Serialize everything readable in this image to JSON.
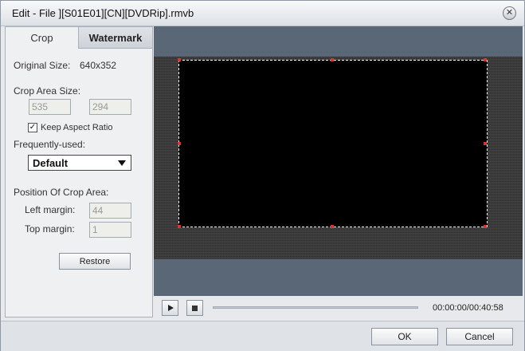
{
  "window": {
    "title": "Edit - File ][S01E01][CN][DVDRip].rmvb",
    "close_icon": "close-icon"
  },
  "tabs": [
    {
      "label": "Crop"
    },
    {
      "label": "Watermark"
    }
  ],
  "crop": {
    "original_size_label": "Original Size:",
    "original_size_value": "640x352",
    "crop_area_size_label": "Crop Area Size:",
    "width_value": "535",
    "height_value": "294",
    "keep_aspect_label": "Keep Aspect Ratio",
    "keep_aspect_checked": true,
    "check_mark": "✓",
    "frequently_used_label": "Frequently-used:",
    "frequently_used_selected": "Default",
    "position_label": "Position Of Crop Area:",
    "left_margin_label": "Left margin:",
    "left_margin_value": "44",
    "top_margin_label": "Top margin:",
    "top_margin_value": "1",
    "restore_label": "Restore"
  },
  "playback": {
    "time": "00:00:00/00:40:58",
    "progress": 0
  },
  "footer": {
    "ok_label": "OK",
    "cancel_label": "Cancel"
  },
  "colors": {
    "preview_bg": "#5a6776",
    "handle": "#e03030"
  }
}
